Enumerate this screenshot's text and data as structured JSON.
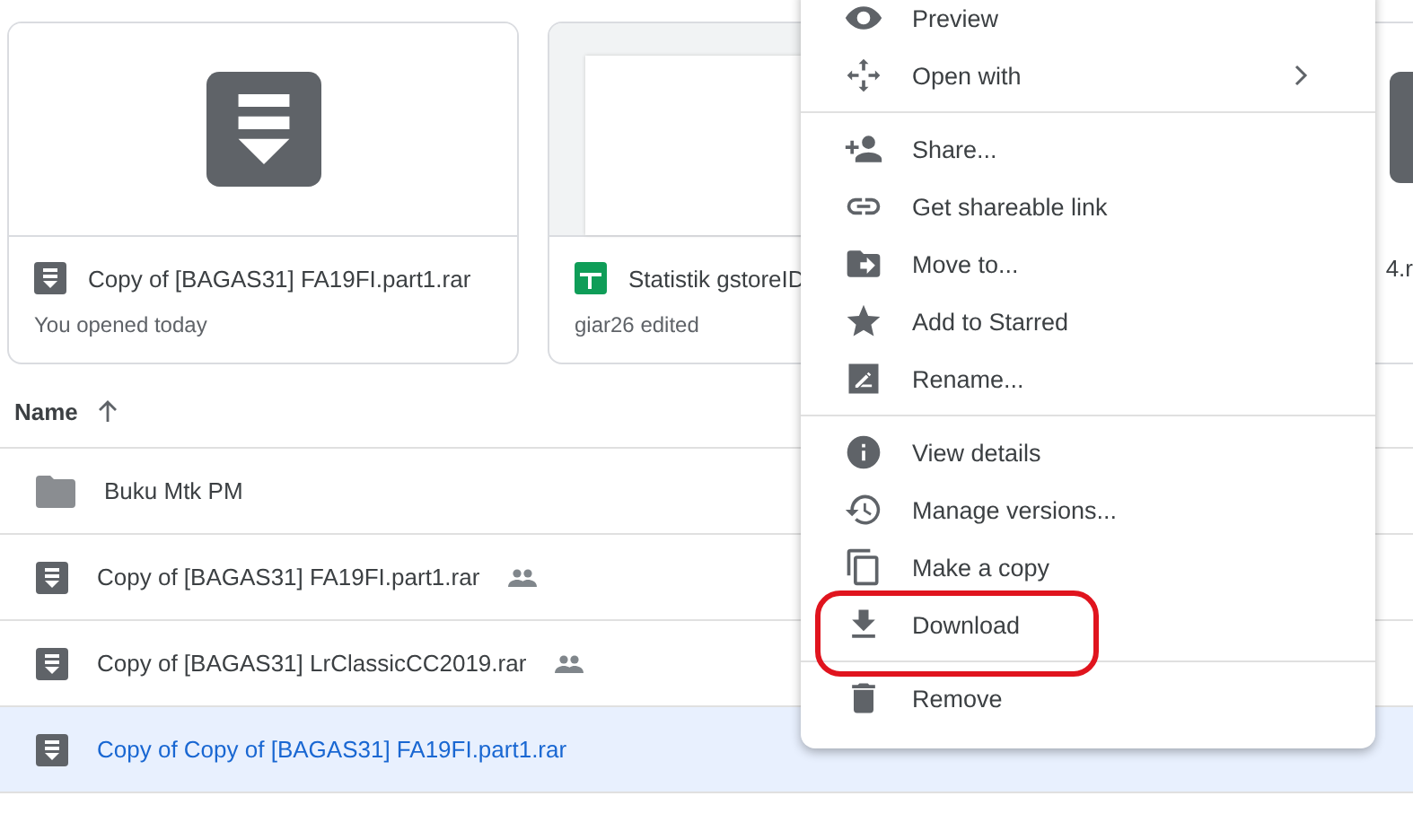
{
  "cards": [
    {
      "kind": "archive",
      "title": "Copy of [BAGAS31] FA19FI.part1.rar",
      "subtitle": "You opened today"
    },
    {
      "kind": "sheet",
      "title": "Statistik gstoreID",
      "subtitle": "giar26 edited"
    },
    {
      "kind": "partial",
      "title": "4.r"
    }
  ],
  "table": {
    "header": {
      "label": "Name"
    },
    "rows": [
      {
        "kind": "folder",
        "name": "Buku Mtk PM",
        "shared": false,
        "selected": false
      },
      {
        "kind": "archive",
        "name": "Copy of [BAGAS31] FA19FI.part1.rar",
        "shared": true,
        "selected": false
      },
      {
        "kind": "archive",
        "name": "Copy of [BAGAS31] LrClassicCC2019.rar",
        "shared": true,
        "selected": false
      },
      {
        "kind": "archive",
        "name": "Copy of Copy of [BAGAS31] FA19FI.part1.rar",
        "shared": false,
        "selected": true
      }
    ]
  },
  "menu": {
    "groups": [
      [
        {
          "label": "Preview",
          "submenu": false,
          "highlighted": false
        },
        {
          "label": "Open with",
          "submenu": true,
          "highlighted": false
        }
      ],
      [
        {
          "label": "Share...",
          "submenu": false,
          "highlighted": false
        },
        {
          "label": "Get shareable link",
          "submenu": false,
          "highlighted": false
        },
        {
          "label": "Move to...",
          "submenu": false,
          "highlighted": false
        },
        {
          "label": "Add to Starred",
          "submenu": false,
          "highlighted": false
        },
        {
          "label": "Rename...",
          "submenu": false,
          "highlighted": false
        }
      ],
      [
        {
          "label": "View details",
          "submenu": false,
          "highlighted": false
        },
        {
          "label": "Manage versions...",
          "submenu": false,
          "highlighted": false
        },
        {
          "label": "Make a copy",
          "submenu": false,
          "highlighted": false
        },
        {
          "label": "Download",
          "submenu": false,
          "highlighted": true
        }
      ],
      [
        {
          "label": "Remove",
          "submenu": false,
          "highlighted": false
        }
      ]
    ]
  }
}
